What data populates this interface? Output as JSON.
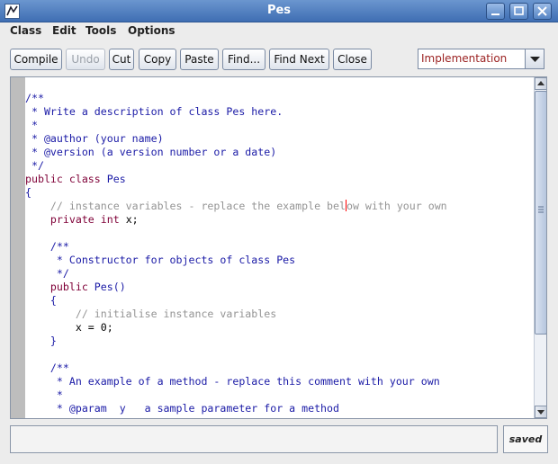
{
  "window": {
    "title": "Pes",
    "icon": "bluej-icon",
    "controls": [
      "minimize-icon",
      "maximize-icon",
      "close-icon"
    ]
  },
  "menu": [
    "Class",
    "Edit",
    "Tools",
    "Options"
  ],
  "toolbar": {
    "buttons": [
      {
        "label": "Compile",
        "enabled": true
      },
      {
        "label": "Undo",
        "enabled": false
      },
      {
        "label": "Cut",
        "enabled": true
      },
      {
        "label": "Copy",
        "enabled": true
      },
      {
        "label": "Paste",
        "enabled": true
      },
      {
        "label": "Find...",
        "enabled": true
      },
      {
        "label": "Find Next",
        "enabled": true
      },
      {
        "label": "Close",
        "enabled": true
      }
    ]
  },
  "view_select": {
    "selected": "Implementation"
  },
  "colors": {
    "comment": "#1a1aa6",
    "grey_comment": "#949494",
    "keyword": "#7f0037",
    "default": "#000000",
    "select_text": "#9b2222"
  },
  "code": {
    "lines": [
      [
        {
          "t": "/**",
          "s": "comment"
        }
      ],
      [
        {
          "t": " * Write a description of class Pes here.",
          "s": "comment"
        }
      ],
      [
        {
          "t": " *",
          "s": "comment"
        }
      ],
      [
        {
          "t": " * @author (your name)",
          "s": "comment"
        }
      ],
      [
        {
          "t": " * @version (a version number or a date)",
          "s": "comment"
        }
      ],
      [
        {
          "t": " */",
          "s": "comment"
        }
      ],
      [
        {
          "t": "public class ",
          "s": "keyword"
        },
        {
          "t": "Pes",
          "s": "comment"
        }
      ],
      [
        {
          "t": "{",
          "s": "comment"
        }
      ],
      [
        {
          "t": "    // instance variables - replace the example bel",
          "s": "grey"
        },
        {
          "t": "",
          "s": "caret"
        },
        {
          "t": "ow with your own",
          "s": "grey"
        }
      ],
      [
        {
          "t": "    private int ",
          "s": "keyword"
        },
        {
          "t": "x;",
          "s": "default"
        }
      ],
      [
        {
          "t": "",
          "s": "default"
        }
      ],
      [
        {
          "t": "    /**",
          "s": "comment"
        }
      ],
      [
        {
          "t": "     * Constructor for objects of class Pes",
          "s": "comment"
        }
      ],
      [
        {
          "t": "     */",
          "s": "comment"
        }
      ],
      [
        {
          "t": "    public ",
          "s": "keyword"
        },
        {
          "t": "Pes()",
          "s": "comment"
        }
      ],
      [
        {
          "t": "    {",
          "s": "comment"
        }
      ],
      [
        {
          "t": "        // initialise instance variables",
          "s": "grey"
        }
      ],
      [
        {
          "t": "        x = 0;",
          "s": "default"
        }
      ],
      [
        {
          "t": "    }",
          "s": "comment"
        }
      ],
      [
        {
          "t": "",
          "s": "default"
        }
      ],
      [
        {
          "t": "    /**",
          "s": "comment"
        }
      ],
      [
        {
          "t": "     * An example of a method - replace this comment with your own",
          "s": "comment"
        }
      ],
      [
        {
          "t": "     *",
          "s": "comment"
        }
      ],
      [
        {
          "t": "     * @param  y   a sample parameter for a method",
          "s": "comment"
        }
      ]
    ]
  },
  "status": {
    "message": "",
    "saved_label": "saved"
  }
}
